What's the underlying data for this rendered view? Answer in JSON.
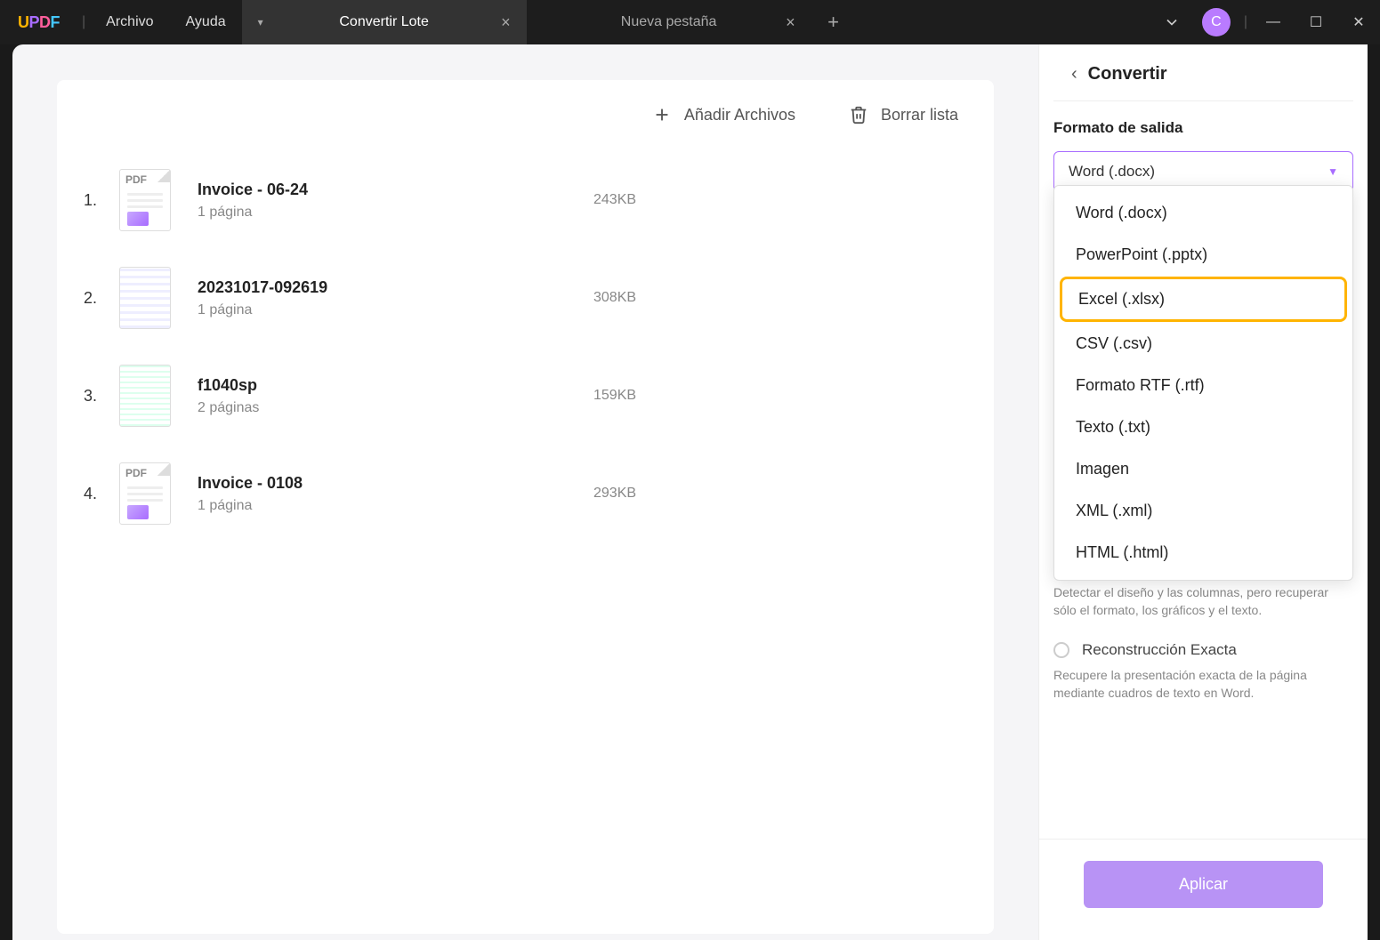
{
  "titlebar": {
    "menu_file": "Archivo",
    "menu_help": "Ayuda",
    "avatar_initial": "C"
  },
  "tabs": {
    "active": "Convertir Lote",
    "inactive": "Nueva pestaña"
  },
  "toolbar": {
    "add_files": "Añadir Archivos",
    "clear_list": "Borrar lista"
  },
  "files": [
    {
      "index": "1.",
      "name": "Invoice - 06-24",
      "pages": "1 página",
      "size": "243KB",
      "thumb": "pdf-generic"
    },
    {
      "index": "2.",
      "name": "20231017-092619",
      "pages": "1 página",
      "size": "308KB",
      "thumb": "doc-thumb"
    },
    {
      "index": "3.",
      "name": "f1040sp",
      "pages": "2 páginas",
      "size": "159KB",
      "thumb": "form-thumb"
    },
    {
      "index": "4.",
      "name": "Invoice - 0108",
      "pages": "1 página",
      "size": "293KB",
      "thumb": "pdf-generic"
    }
  ],
  "sidebar": {
    "title": "Convertir",
    "format_label": "Formato de salida",
    "selected_format": "Word (.docx)",
    "options": [
      "Word (.docx)",
      "PowerPoint (.pptx)",
      "Excel (.xlsx)",
      "CSV (.csv)",
      "Formato RTF (.rtf)",
      "Texto (.txt)",
      "Imagen",
      "XML (.xml)",
      "HTML (.html)"
    ],
    "highlight_index": 2,
    "desc1": "Detectar el diseño y las columnas, pero recuperar sólo el formato, los gráficos y el texto.",
    "radio2_label": "Reconstrucción Exacta",
    "desc2": "Recupere la presentación exacta de la página mediante cuadros de texto en Word.",
    "apply": "Aplicar"
  }
}
